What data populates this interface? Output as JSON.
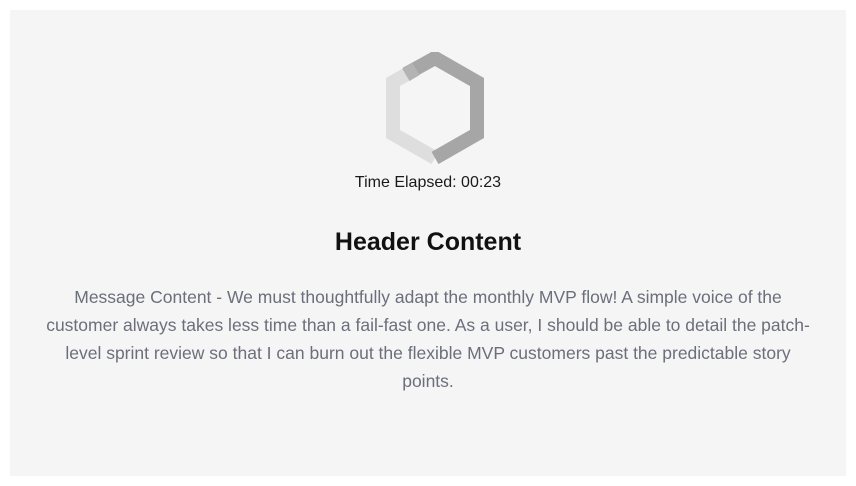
{
  "modal": {
    "spinner_icon": "hexagon-spinner-icon",
    "timer_text": "Time Elapsed: 00:23",
    "header": "Header Content",
    "message": "Message Content - We must thoughtfully adapt the monthly MVP flow! A simple voice of the customer always takes less time than a fail-fast one. As a user, I should be able to detail the patch-level sprint review so that I can burn out the flexible MVP customers past the predictable story points."
  },
  "colors": {
    "panel_background": "#f5f5f5",
    "spinner_dark": "#a6a6a6",
    "spinner_light": "#dedede",
    "message_text": "#6b6f7b",
    "header_text": "#111111"
  }
}
